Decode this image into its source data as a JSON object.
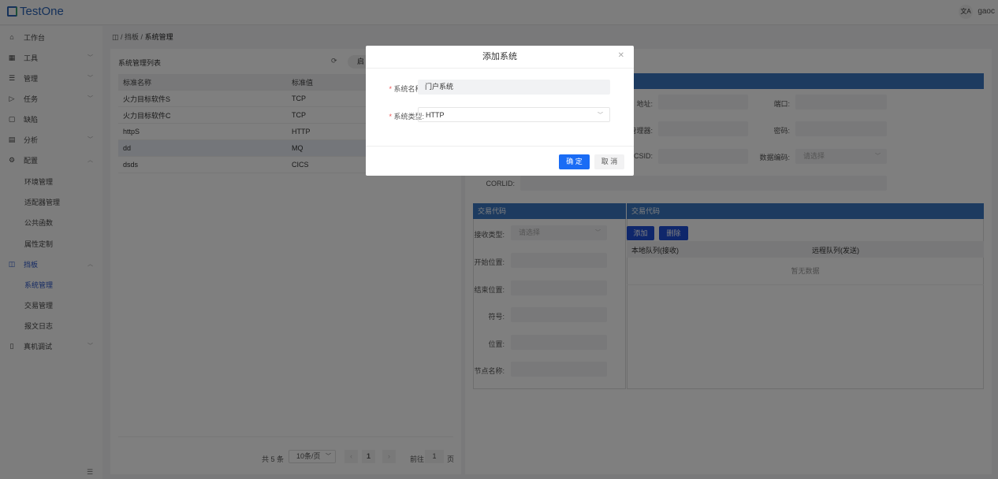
{
  "app": {
    "logo": "TestOne",
    "user": "gaoc",
    "lang_icon": "文A"
  },
  "sidebar": {
    "items": [
      {
        "label": "工作台",
        "icon": "home-icon"
      },
      {
        "label": "工具",
        "icon": "grid-icon"
      },
      {
        "label": "管理",
        "icon": "list-icon"
      },
      {
        "label": "任务",
        "icon": "send-icon"
      },
      {
        "label": "缺陷",
        "icon": "doc-icon"
      },
      {
        "label": "分析",
        "icon": "calendar-icon"
      },
      {
        "label": "配置",
        "icon": "gear-icon"
      },
      {
        "label": "挡板",
        "icon": "panel-icon"
      },
      {
        "label": "真机调试",
        "icon": "device-icon"
      }
    ],
    "config_sub": [
      "环境管理",
      "适配器管理",
      "公共函数",
      "属性定制"
    ],
    "baffle_sub": [
      "系统管理",
      "交易管理",
      "报文日志"
    ]
  },
  "breadcrumb": [
    "挡板",
    "系统管理"
  ],
  "list": {
    "title": "系统管理列表",
    "partial_button": "启",
    "headers": [
      "标准名称",
      "标准值"
    ],
    "rows": [
      [
        "火力目标软件S",
        "TCP"
      ],
      [
        "火力目标软件C",
        "TCP"
      ],
      [
        "httpS",
        "HTTP"
      ],
      [
        "dd",
        "MQ"
      ],
      [
        "dsds",
        "CICS"
      ]
    ]
  },
  "pagination": {
    "total": "共 5 条",
    "page_size": "10条/页",
    "current": "1",
    "goto_label": "前往",
    "goto_value": "1",
    "page_suffix": "页"
  },
  "detail": {
    "fields": {
      "address": "地址:",
      "port": "端口:",
      "manager": "管理器:",
      "password": "密码:",
      "ccsid": "CCSID:",
      "encoding": "数据编码:",
      "encoding_placeholder": "请选择",
      "corlid": "CORLID:"
    },
    "left_section": {
      "title": "交易代码",
      "receive_type": "接收类型:",
      "receive_placeholder": "请选择",
      "start": "开始位置:",
      "end": "结束位置:",
      "symbol": "符号:",
      "position": "位置:",
      "node": "节点名称:"
    },
    "right_section": {
      "title": "交易代码",
      "add": "添加",
      "delete": "删除",
      "headers": [
        "本地队列(接收)",
        "远程队列(发送)"
      ],
      "empty": "暂无数据"
    }
  },
  "dialog": {
    "title": "添加系统",
    "name_label": "系统名称:",
    "name_value": "门户系统",
    "type_label": "系统类型:",
    "type_value": "HTTP",
    "confirm": "确 定",
    "cancel": "取 消"
  }
}
